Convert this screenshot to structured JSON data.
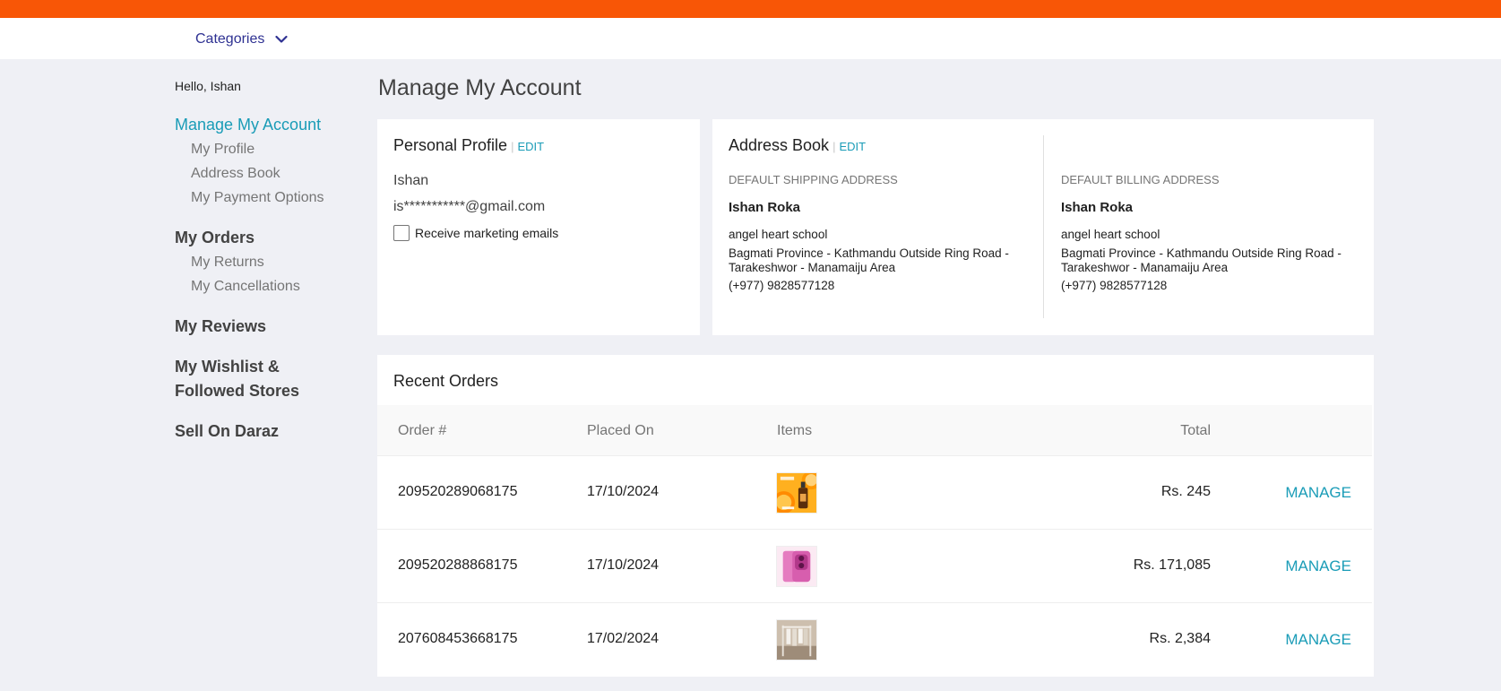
{
  "header": {
    "categories_label": "Categories"
  },
  "sidebar": {
    "greeting": "Hello, Ishan",
    "manage_account": "Manage My Account",
    "my_profile": "My Profile",
    "address_book": "Address Book",
    "payment_options": "My Payment Options",
    "my_orders": "My Orders",
    "my_returns": "My Returns",
    "my_cancellations": "My Cancellations",
    "my_reviews": "My Reviews",
    "wishlist_line1": "My Wishlist &",
    "wishlist_line2": "Followed Stores",
    "sell": "Sell On Daraz"
  },
  "page_title": "Manage My Account",
  "personal_profile": {
    "title": "Personal Profile",
    "sep": "|",
    "edit": "EDIT",
    "name": "Ishan",
    "email": "is***********@gmail.com",
    "marketing_label": "Receive marketing emails"
  },
  "address_book": {
    "title": "Address Book",
    "sep": "|",
    "edit": "EDIT",
    "shipping": {
      "label": "DEFAULT SHIPPING ADDRESS",
      "name": "Ishan Roka",
      "line1": "angel heart school",
      "line2": "Bagmati Province - Kathmandu Outside Ring Road -",
      "line3": "Tarakeshwor - Manamaiju Area",
      "phone": "(+977) 9828577128"
    },
    "billing": {
      "label": "DEFAULT BILLING ADDRESS",
      "name": "Ishan Roka",
      "line1": "angel heart school",
      "line2": "Bagmati Province - Kathmandu Outside Ring Road -",
      "line3": "Tarakeshwor - Manamaiju Area",
      "phone": "(+977) 9828577128"
    }
  },
  "recent_orders": {
    "title": "Recent Orders",
    "columns": {
      "order": "Order #",
      "placed": "Placed On",
      "items": "Items",
      "total": "Total"
    },
    "rows": [
      {
        "order": "209520289068175",
        "placed": "17/10/2024",
        "total": "Rs. 245",
        "action": "MANAGE",
        "item": "serum-bottle-thumbnail"
      },
      {
        "order": "209520288868175",
        "placed": "17/10/2024",
        "total": "Rs. 171,085",
        "action": "MANAGE",
        "item": "pink-phone-thumbnail"
      },
      {
        "order": "207608453668175",
        "placed": "17/02/2024",
        "total": "Rs. 2,384",
        "action": "MANAGE",
        "item": "clothes-rack-thumbnail"
      }
    ]
  },
  "colors": {
    "brand_orange": "#f85606",
    "link_teal": "#1a9cb7",
    "category_blue": "#2e3192"
  }
}
